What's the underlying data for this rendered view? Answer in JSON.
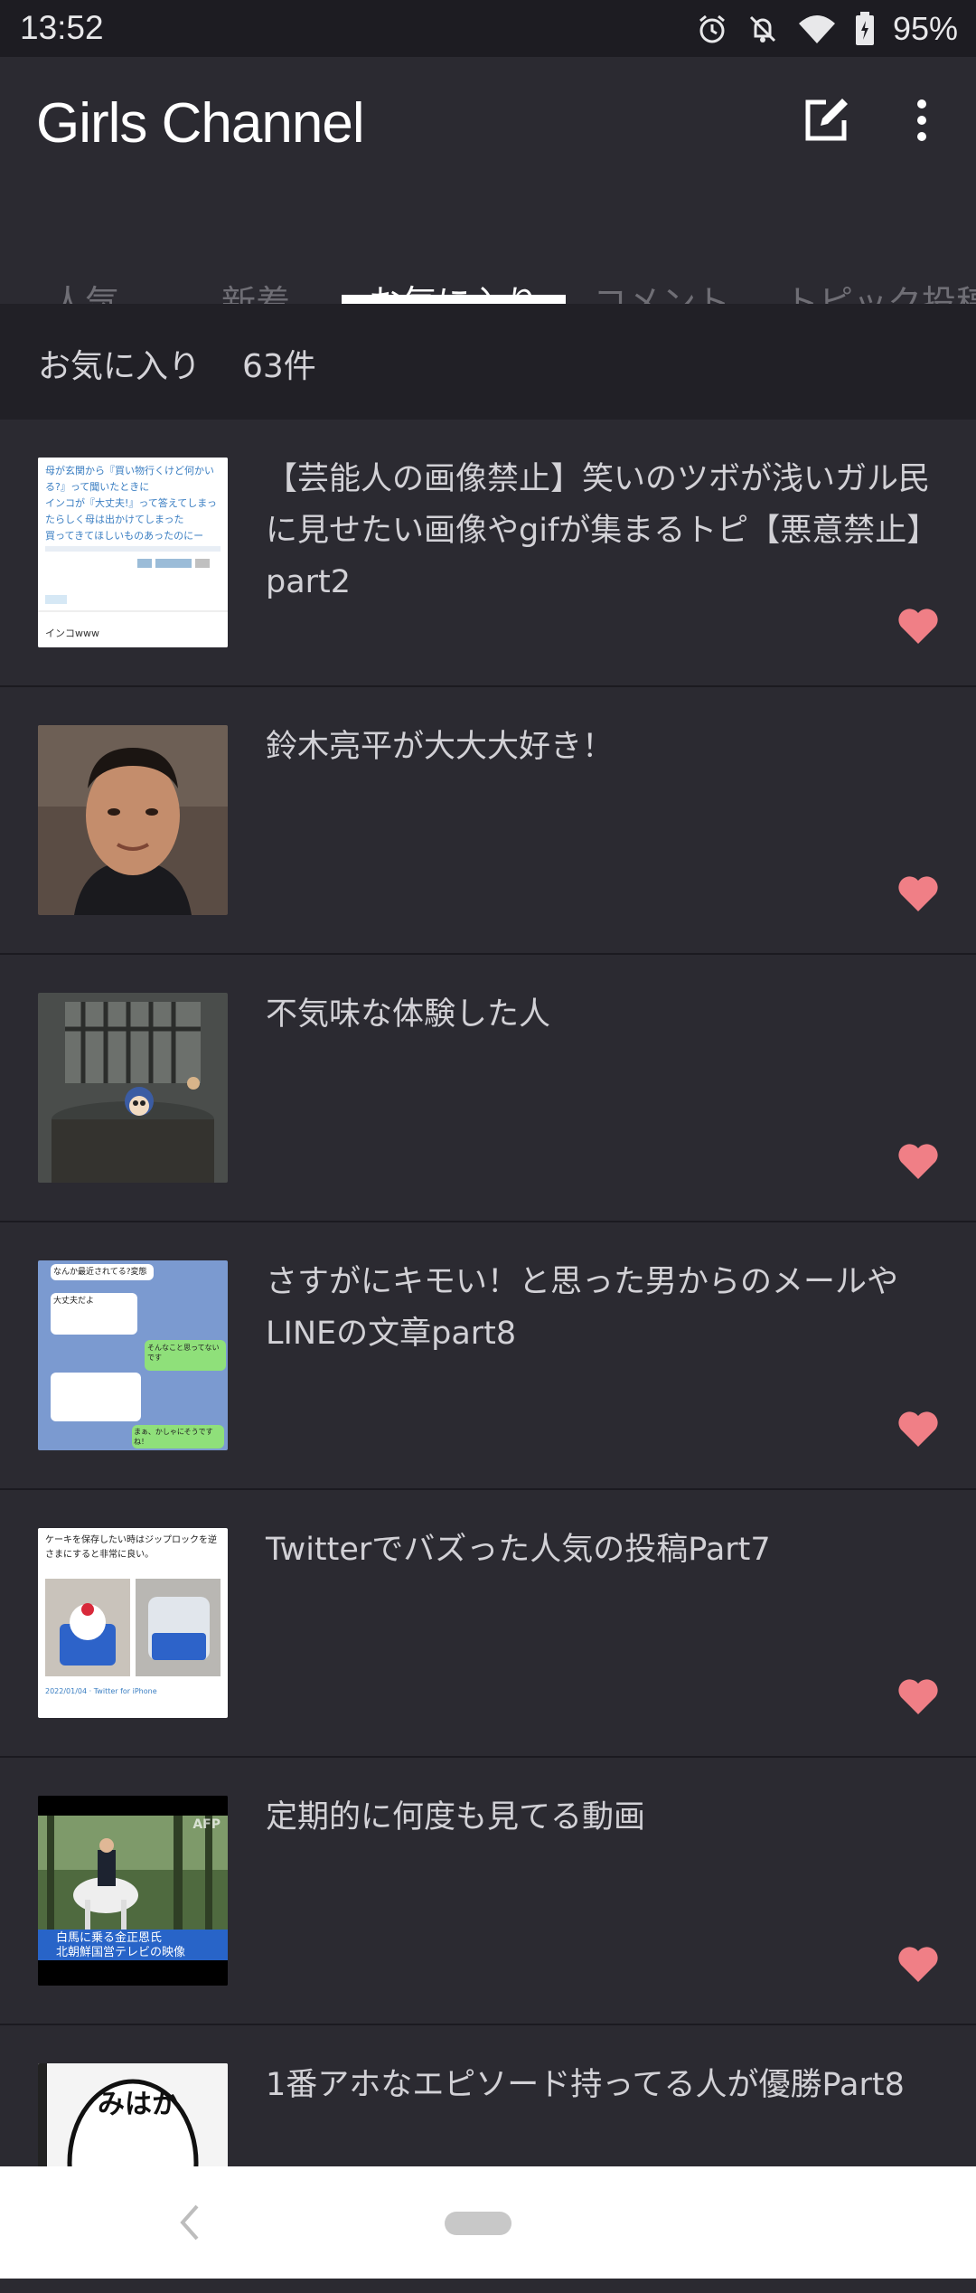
{
  "status_bar": {
    "time": "13:52",
    "battery": "95%",
    "icons": [
      "alarm-icon",
      "bell-off-icon",
      "wifi-icon",
      "battery-icon"
    ]
  },
  "app_bar": {
    "title": "Girls Channel",
    "icons": [
      "edit-icon",
      "more-vert-icon"
    ]
  },
  "tabs": [
    {
      "label": "人気"
    },
    {
      "label": "新着"
    },
    {
      "label": "お気に入り"
    },
    {
      "label": "コメント"
    },
    {
      "label": "トピック投稿"
    }
  ],
  "active_tab": "お気に入り",
  "section": {
    "label": "お気に入り",
    "count": "63件"
  },
  "topics": [
    {
      "title": "【芸能人の画像禁止】笑いのツボが浅いガル民に見せたい画像やgifが集まるトピ【悪意禁止】part2",
      "favorited": true,
      "thumb_text": [
        "母が玄関から『買い物行くけど何かいる?』って聞いたときに",
        "インコが『大丈夫!』って答えてしまったらしく母は出かけてしまった",
        "買ってきてほしいものあったのにー",
        "インコwww"
      ]
    },
    {
      "title": "鈴木亮平が大大大好き！",
      "favorited": true,
      "thumb_text": []
    },
    {
      "title": "不気味な体験した人",
      "favorited": true,
      "thumb_text": []
    },
    {
      "title": "さすがにキモい！と思った男からのメールやLINEの文章part8",
      "favorited": true,
      "thumb_text": [
        "なんか最近されてる?変態",
        "大丈夫だよ",
        "そんなこと思ってないです",
        "まぁ、かしゃにそうですね！"
      ]
    },
    {
      "title": "Twitterでバズった人気の投稿Part7",
      "favorited": true,
      "thumb_text": [
        "ケーキを保存したい時はジップロックを逆さまにすると非常に良い。",
        "2022/01/04 · Twitter for iPhone"
      ]
    },
    {
      "title": "定期的に何度も見てる動画",
      "favorited": true,
      "thumb_text": [
        "AFP",
        "白馬に乗る金正恩氏",
        "北朝鮮国営テレビの映像"
      ]
    },
    {
      "title": "1番アホなエピソード持ってる人が優勝Part8",
      "favorited": true,
      "thumb_text": [
        "みはか"
      ]
    }
  ],
  "colors": {
    "background": "#2b2a31",
    "header_strip": "#212026",
    "heart": "#f07f86",
    "tab_active": "#ffffff",
    "tab_inactive": "#6f6e75"
  }
}
